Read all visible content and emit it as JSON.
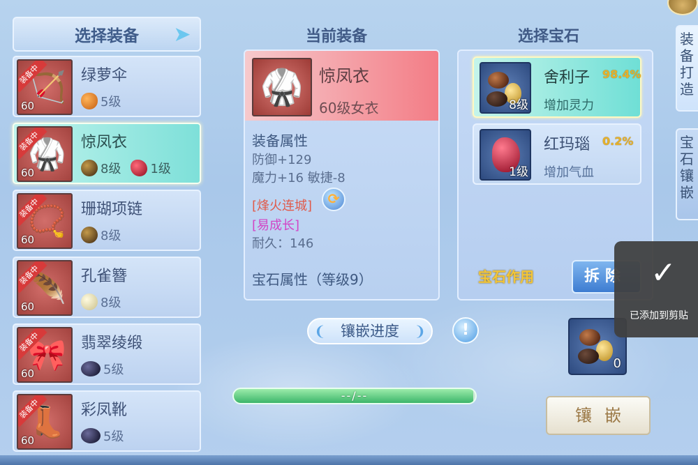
{
  "left": {
    "header": "选择装备",
    "items": [
      {
        "name": "绿萝伞",
        "tag": "装备中",
        "level": "60",
        "art": "🏹",
        "gems": [
          {
            "type": "orange",
            "level": "5级"
          }
        ]
      },
      {
        "name": "惊凤衣",
        "tag": "装备中",
        "level": "60",
        "art": "🥋",
        "gems": [
          {
            "type": "brown",
            "level": "8级"
          },
          {
            "type": "red",
            "level": "1级"
          }
        ]
      },
      {
        "name": "珊瑚项链",
        "tag": "装备中",
        "level": "60",
        "art": "📿",
        "gems": [
          {
            "type": "brown",
            "level": "8级"
          }
        ]
      },
      {
        "name": "孔雀簪",
        "tag": "装备中",
        "level": "60",
        "art": "🪶",
        "gems": [
          {
            "type": "pearl",
            "level": "8级"
          }
        ]
      },
      {
        "name": "翡翠绫缎",
        "tag": "装备中",
        "level": "60",
        "art": "🎀",
        "gems": [
          {
            "type": "dark",
            "level": "5级"
          }
        ]
      },
      {
        "name": "彩凤靴",
        "tag": "装备中",
        "level": "60",
        "art": "👢",
        "gems": [
          {
            "type": "dark",
            "level": "5级"
          }
        ]
      }
    ]
  },
  "middle": {
    "title": "当前装备",
    "item_name": "惊凤衣",
    "item_level": "60级女衣",
    "attr_title": "装备属性",
    "attr_lines": [
      "防御+129",
      "魔力+16 敏捷-8"
    ],
    "special_1": "[烽火连城]",
    "special_2": "[易成长]",
    "durability": "耐久：146",
    "gem_attr_title": "宝石属性（等级9）"
  },
  "right": {
    "title": "选择宝石",
    "gems": [
      {
        "name": "舍利子",
        "pct": "98.4%",
        "level": "8级",
        "effect": "增加灵力"
      },
      {
        "name": "红玛瑙",
        "pct": "0.2%",
        "level": "1级",
        "effect": "增加气血"
      }
    ],
    "function_label": "宝石作用",
    "remove_label": "拆除"
  },
  "progress": {
    "title": "镶嵌进度",
    "info_icon": "!",
    "text": "--/--",
    "fill_fraction": 0.99
  },
  "inlay": {
    "slot_count": "0",
    "button_label": "镶嵌"
  },
  "side_tabs": [
    "装备打造",
    "宝石镶嵌"
  ],
  "toast": {
    "message": "已添加到剪贴"
  }
}
